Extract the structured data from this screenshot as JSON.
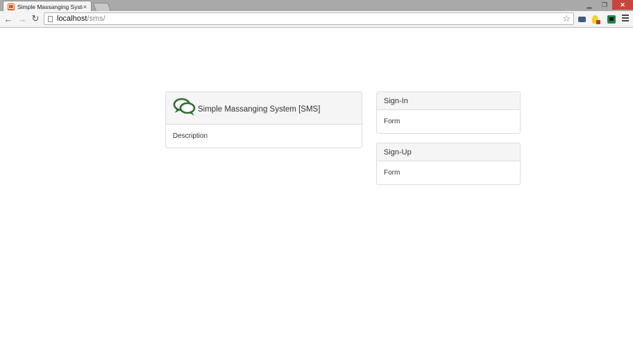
{
  "browser": {
    "tab_title": "Simple Massanging Syster",
    "tab_close": "×",
    "window_buttons": {
      "minimize": "▁",
      "maximize": "❐",
      "close": "✕"
    },
    "nav": {
      "back": "←",
      "forward": "→",
      "reload": "↻"
    },
    "url_host": "localhost",
    "url_path": "/sms/",
    "star": "☆",
    "extensions": [
      "camera-extension-icon",
      "bulb-extension-icon",
      "green-extension-icon"
    ]
  },
  "main_panel": {
    "title": "Simple Massanging System [SMS]",
    "body": "Description",
    "icon": "chat-bubbles-icon",
    "icon_color": "#2f6e2f"
  },
  "signin_panel": {
    "title": "Sign-In",
    "body": "Form"
  },
  "signup_panel": {
    "title": "Sign-Up",
    "body": "Form"
  }
}
